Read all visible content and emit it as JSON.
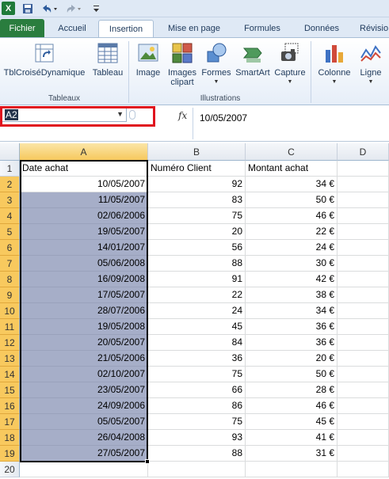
{
  "quick_access": {
    "logo": "X",
    "save_icon": "save-icon",
    "undo_icon": "undo-icon",
    "redo_icon": "redo-icon"
  },
  "tabs": [
    {
      "label": "Fichier"
    },
    {
      "label": "Accueil"
    },
    {
      "label": "Insertion"
    },
    {
      "label": "Mise en page"
    },
    {
      "label": "Formules"
    },
    {
      "label": "Données"
    },
    {
      "label": "Révisio"
    }
  ],
  "ribbon": {
    "pivot_label": "TblCroiséDynamique",
    "table_label": "Tableau",
    "group_tables": "Tableaux",
    "image_label": "Image",
    "images_label_1": "Images",
    "images_label_2": "clipart",
    "shapes_label": "Formes",
    "smartart_label": "SmartArt",
    "capture_label": "Capture",
    "group_illustrations": "Illustrations",
    "column_label": "Colonne",
    "line_label": "Ligne"
  },
  "formula_bar": {
    "name_box": "A2",
    "fx": "fx",
    "value": "10/05/2007"
  },
  "grid": {
    "columns": [
      "A",
      "B",
      "C",
      "D"
    ],
    "headers": [
      "Date achat",
      "Numéro Client",
      "Montant achat"
    ],
    "rows": [
      [
        "10/05/2007",
        "92",
        "34 €"
      ],
      [
        "11/05/2007",
        "83",
        "50 €"
      ],
      [
        "02/06/2006",
        "75",
        "46 €"
      ],
      [
        "19/05/2007",
        "20",
        "22 €"
      ],
      [
        "14/01/2007",
        "56",
        "24 €"
      ],
      [
        "05/06/2008",
        "88",
        "30 €"
      ],
      [
        "16/09/2008",
        "91",
        "42 €"
      ],
      [
        "17/05/2007",
        "22",
        "38 €"
      ],
      [
        "28/07/2006",
        "24",
        "34 €"
      ],
      [
        "19/05/2008",
        "45",
        "36 €"
      ],
      [
        "20/05/2007",
        "84",
        "36 €"
      ],
      [
        "21/05/2006",
        "36",
        "20 €"
      ],
      [
        "02/10/2007",
        "75",
        "50 €"
      ],
      [
        "23/05/2007",
        "66",
        "28 €"
      ],
      [
        "24/09/2006",
        "86",
        "46 €"
      ],
      [
        "05/05/2007",
        "75",
        "45 €"
      ],
      [
        "26/04/2008",
        "93",
        "41 €"
      ],
      [
        "27/05/2007",
        "88",
        "31 €"
      ]
    ],
    "row_numbers": [
      "1",
      "2",
      "3",
      "4",
      "5",
      "6",
      "7",
      "8",
      "9",
      "10",
      "11",
      "12",
      "13",
      "14",
      "15",
      "16",
      "17",
      "18",
      "19",
      "20"
    ]
  },
  "colors": {
    "selection": "#a6aec8",
    "header_selected": "#f6c85d",
    "highlight_box": "#e0141e",
    "file_tab": "#2a7d3e"
  }
}
